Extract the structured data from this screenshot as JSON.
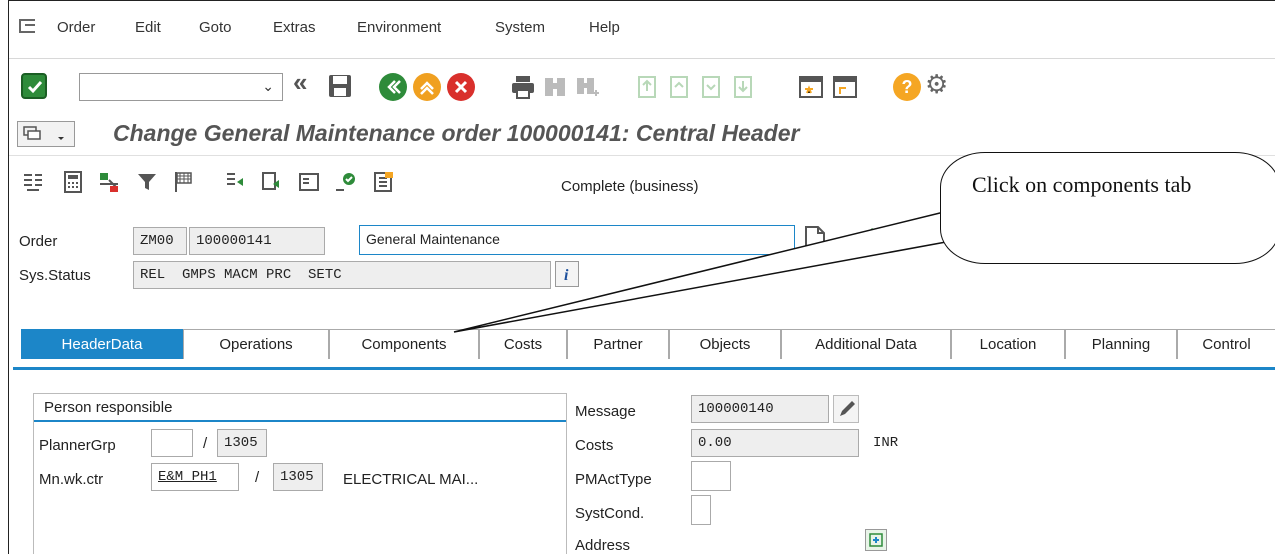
{
  "menu": {
    "items": [
      {
        "label": "Order"
      },
      {
        "label": "Edit"
      },
      {
        "label": "Goto"
      },
      {
        "label": "Extras"
      },
      {
        "label": "Environment"
      },
      {
        "label": "System"
      },
      {
        "label": "Help"
      }
    ]
  },
  "toolbar": {
    "command_value": "",
    "icons": [
      "enter-icon",
      "back-double-icon",
      "save-icon",
      "back-icon",
      "exit-icon",
      "cancel-icon",
      "print-icon",
      "find-icon",
      "find-next-icon",
      "first-page-icon",
      "previous-page-icon",
      "next-page-icon",
      "last-page-icon",
      "new-session-icon",
      "shortcut-icon",
      "help-icon",
      "settings-icon"
    ]
  },
  "title": "Change General Maintenance order 100000141: Central Header",
  "app_toolbar": {
    "status_text": "Complete (business)"
  },
  "header": {
    "order_label": "Order",
    "order_type": "ZM00",
    "order_number": "100000141",
    "order_description": "General Maintenance",
    "sys_status_label": "Sys.Status",
    "sys_status_value": "REL  GMPS MACM PRC  SETC"
  },
  "tabs": [
    {
      "label": "HeaderData",
      "active": true
    },
    {
      "label": "Operations"
    },
    {
      "label": "Components"
    },
    {
      "label": "Costs"
    },
    {
      "label": "Partner"
    },
    {
      "label": "Objects"
    },
    {
      "label": "Additional Data"
    },
    {
      "label": "Location"
    },
    {
      "label": "Planning"
    },
    {
      "label": "Control"
    }
  ],
  "person_responsible": {
    "title": "Person responsible",
    "planner_grp_label": "PlannerGrp",
    "planner_grp_value": "",
    "planner_plant": "1305",
    "mn_wk_ctr_label": "Mn.wk.ctr",
    "mn_wk_ctr_value": "E&M_PH1",
    "mn_wk_ctr_plant": "1305",
    "mn_wk_ctr_desc": "ELECTRICAL MAI..."
  },
  "right_fields": {
    "message_label": "Message",
    "message_value": "100000140",
    "costs_label": "Costs",
    "costs_value": "0.00",
    "costs_currency": "INR",
    "pmacttype_label": "PMActType",
    "pmacttype_value": "",
    "systcond_label": "SystCond.",
    "systcond_value": "",
    "address_label": "Address"
  },
  "separator": "/",
  "callout": {
    "text": "Click on components tab"
  },
  "colors": {
    "accent": "#1c86c8",
    "ok_green": "#2e8b3a",
    "exit_orange": "#f0a020",
    "cancel_red": "#d9302c",
    "help_orange": "#f5a623"
  }
}
